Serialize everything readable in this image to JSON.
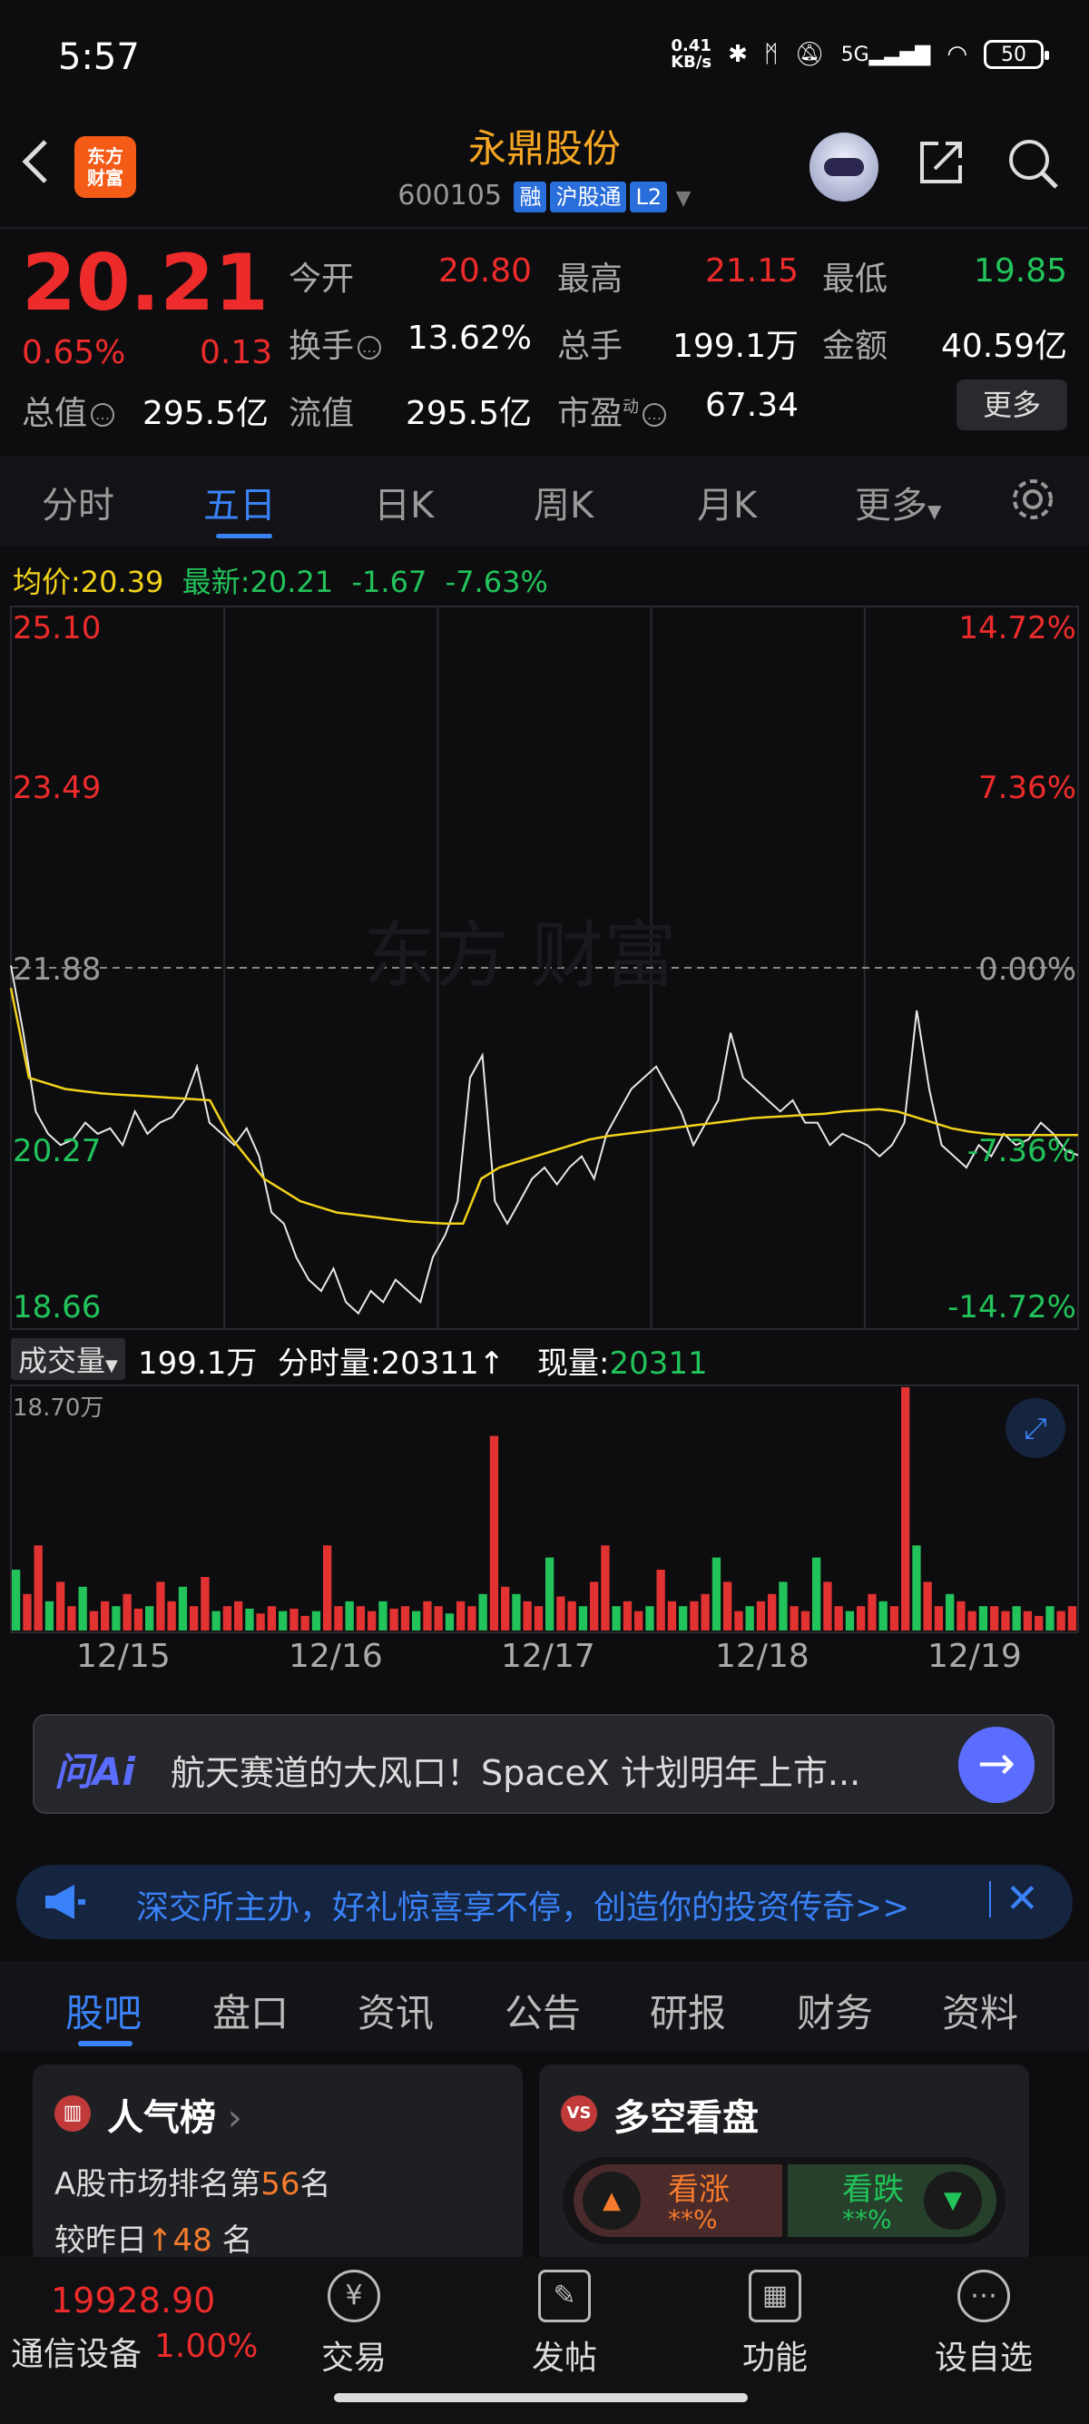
{
  "status": {
    "time": "5:57",
    "net_speed": "0.41\nKB/s",
    "net_speed_top": "0.41",
    "net_speed_unit": "KB/s",
    "battery": "50",
    "signal": "5G"
  },
  "header": {
    "back_icon": "chevron-left-icon",
    "logo_text": "东方\n财富",
    "logo_line1": "东方",
    "logo_line2": "财富",
    "title": "永鼎股份",
    "code": "600105",
    "tags": [
      "融",
      "沪股通",
      "L2"
    ]
  },
  "quote": {
    "price": "20.21",
    "change_pct": "0.65%",
    "change": "0.13",
    "open_label": "今开",
    "open": "20.80",
    "high_label": "最高",
    "high": "21.15",
    "low_label": "最低",
    "low": "19.85",
    "turnover_label": "换手",
    "turnover": "13.62%",
    "volume_label": "总手",
    "volume": "199.1万",
    "amount_label": "金额",
    "amount": "40.59亿",
    "mktcap_label": "总值",
    "mktcap": "295.5亿",
    "float_label": "流值",
    "float": "295.5亿",
    "pe_label": "市盈",
    "pe_sup": "动",
    "pe": "67.34",
    "more_label": "更多"
  },
  "tabs": {
    "items": [
      "分时",
      "五日",
      "日K",
      "周K",
      "月K",
      "更多"
    ],
    "active": "五日"
  },
  "chart_header": {
    "avg_label": "均价:",
    "avg": "20.39",
    "latest_label": "最新:",
    "latest": "20.21",
    "chg": "-1.67",
    "chg_pct": "-7.63%"
  },
  "chart_data": {
    "type": "line",
    "title": "",
    "y_left_ticks": [
      "25.10",
      "23.49",
      "21.88",
      "20.27",
      "18.66"
    ],
    "y_right_ticks": [
      "14.72%",
      "7.36%",
      "0.00%",
      "-7.36%",
      "-14.72%"
    ],
    "ylim": [
      18.66,
      25.1
    ],
    "prev_close": 21.88,
    "x_dates": [
      "12/15",
      "12/16",
      "12/17",
      "12/18",
      "12/19"
    ],
    "series": [
      {
        "values": [
          21.9,
          21.3,
          20.6,
          20.4,
          20.3,
          20.35,
          20.5,
          20.4,
          20.45,
          20.3,
          20.6,
          20.4,
          20.5,
          20.55,
          20.7,
          21.0,
          20.5,
          20.4,
          20.3,
          20.45,
          20.2,
          19.7,
          19.6,
          19.3,
          19.1,
          19.0,
          19.2,
          18.9,
          18.8,
          19.0,
          18.9,
          19.1,
          19.0,
          18.9,
          19.3,
          19.5,
          19.8,
          20.9,
          21.1,
          19.8,
          19.6,
          19.8,
          20.0,
          20.1,
          19.95,
          20.1,
          20.2,
          20.0,
          20.4,
          20.6,
          20.8,
          20.9,
          21.0,
          20.8,
          20.6,
          20.3,
          20.5,
          20.7,
          21.3,
          20.9,
          20.8,
          20.7,
          20.6,
          20.7,
          20.5,
          20.5,
          20.3,
          20.4,
          20.35,
          20.3,
          20.2,
          20.3,
          20.5,
          21.5,
          20.8,
          20.3,
          20.2,
          20.1,
          20.3,
          20.2,
          20.4,
          20.3,
          20.35,
          20.5,
          20.4,
          20.25,
          20.21
        ]
      },
      {
        "values": [
          21.7,
          20.9,
          20.85,
          20.8,
          20.78,
          20.76,
          20.75,
          20.74,
          20.73,
          20.72,
          20.71,
          20.7,
          20.4,
          20.2,
          20.0,
          19.9,
          19.8,
          19.75,
          19.7,
          19.68,
          19.66,
          19.64,
          19.62,
          19.61,
          19.6,
          19.6,
          20.0,
          20.1,
          20.15,
          20.2,
          20.25,
          20.3,
          20.35,
          20.38,
          20.4,
          20.42,
          20.44,
          20.46,
          20.48,
          20.5,
          20.52,
          20.54,
          20.55,
          20.56,
          20.57,
          20.58,
          20.6,
          20.61,
          20.62,
          20.6,
          20.55,
          20.5,
          20.45,
          20.42,
          20.4,
          20.39,
          20.39,
          20.39,
          20.39,
          20.39
        ]
      }
    ],
    "volume": {
      "label": "成交量",
      "total": "199.1万",
      "tick_label": "分时量:",
      "tick_vol": "20311",
      "now_label": "现量:",
      "now_vol": "20311",
      "max_label": "18.70万",
      "values": [
        0.25,
        0.15,
        0.35,
        0.12,
        0.2,
        0.1,
        0.18,
        0.08,
        0.12,
        0.1,
        0.15,
        0.09,
        0.1,
        0.2,
        0.12,
        0.18,
        0.1,
        0.22,
        0.08,
        0.1,
        0.12,
        0.09,
        0.07,
        0.1,
        0.08,
        0.09,
        0.06,
        0.08,
        0.35,
        0.1,
        0.12,
        0.1,
        0.08,
        0.12,
        0.09,
        0.1,
        0.08,
        0.12,
        0.1,
        0.07,
        0.12,
        0.1,
        0.15,
        0.8,
        0.18,
        0.15,
        0.12,
        0.1,
        0.3,
        0.14,
        0.12,
        0.1,
        0.2,
        0.35,
        0.1,
        0.12,
        0.08,
        0.1,
        0.25,
        0.12,
        0.1,
        0.12,
        0.15,
        0.3,
        0.2,
        0.08,
        0.1,
        0.12,
        0.15,
        0.2,
        0.1,
        0.08,
        0.3,
        0.2,
        0.1,
        0.08,
        0.1,
        0.15,
        0.12,
        0.1,
        1.0,
        0.35,
        0.2,
        0.1,
        0.15,
        0.12,
        0.08,
        0.1,
        0.1,
        0.08,
        0.1,
        0.08,
        0.06,
        0.1,
        0.08,
        0.1
      ]
    }
  },
  "ai_bar": {
    "logo": "问Ai",
    "text": "航天赛道的大风口！SpaceX 计划明年上市..."
  },
  "promo": {
    "text": "深交所主办，好礼惊喜享不停，创造你的投资传奇>>",
    "close": "✕"
  },
  "bottom_tabs": {
    "items": [
      "股吧",
      "盘口",
      "资讯",
      "公告",
      "研报",
      "财务",
      "资料"
    ],
    "active": "股吧"
  },
  "popularity": {
    "title": "人气榜",
    "rank_prefix": "A股市场排名第",
    "rank": "56",
    "rank_suffix": "名",
    "cmp_prefix": "较昨日",
    "cmp_arrow": "↑",
    "cmp": "48",
    "cmp_suffix": " 名"
  },
  "bull_bear": {
    "title": "多空看盘",
    "up_label": "看涨",
    "up_val": "**%",
    "down_label": "看跌",
    "down_val": "**%"
  },
  "footer": {
    "index_val": "19928.90",
    "sector": "通信设备",
    "sector_pct": "1.00%",
    "items": [
      "交易",
      "发帖",
      "功能",
      "设自选"
    ]
  }
}
